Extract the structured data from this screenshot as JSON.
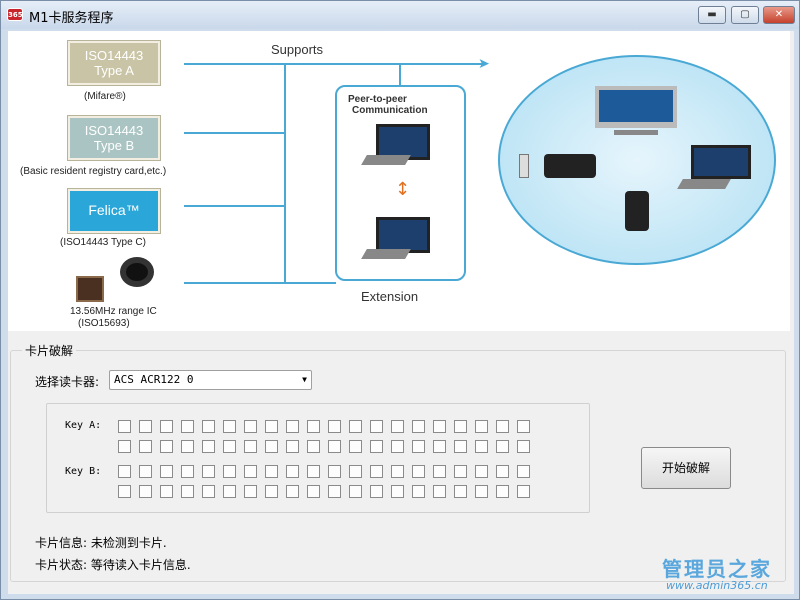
{
  "window": {
    "title": "M1卡服务程序",
    "icon_text": "365"
  },
  "titlebar_buttons": {
    "minimize": "▬",
    "maximize": "▢",
    "close": "✕"
  },
  "banner": {
    "supports": "Supports",
    "extension": "Extension",
    "p2p_line1": "Peer-to-peer",
    "p2p_line2": "Communication",
    "cards": [
      {
        "line1": "ISO14443",
        "line2": "Type A",
        "caption": "(Mifare®)"
      },
      {
        "line1": "ISO14443",
        "line2": "Type B",
        "caption": "(Basic resident registry card,etc.)"
      },
      {
        "line1": "Felica™",
        "line2": "",
        "caption": "(ISO14443 Type C)"
      }
    ],
    "ic_caption1": "13.56MHz range IC",
    "ic_caption2": "(ISO15693)"
  },
  "crack": {
    "group_label": "卡片破解",
    "reader_label": "选择读卡器:",
    "reader_value": "ACS ACR122 0",
    "key_a_label": "Key A:",
    "key_b_label": "Key B:",
    "start_button": "开始破解",
    "card_info": "卡片信息: 未检测到卡片.",
    "card_status": "卡片状态: 等待读入卡片信息."
  },
  "watermark": {
    "line1": "管理员之家",
    "line2": "www.admin365.cn"
  }
}
